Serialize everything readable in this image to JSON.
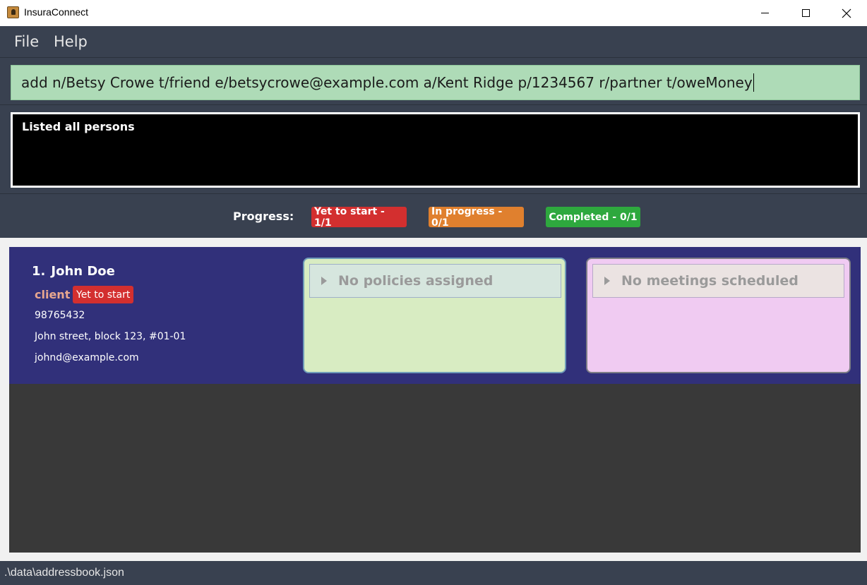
{
  "window": {
    "title": "InsuraConnect",
    "icon": "addressbook-app-icon",
    "controls": [
      "minimize-icon",
      "maximize-icon",
      "close-icon"
    ]
  },
  "menu": {
    "file": "File",
    "help": "Help"
  },
  "command": {
    "value": "add n/Betsy Crowe t/friend e/betsycrowe@example.com a/Kent Ridge p/1234567 r/partner t/oweMoney"
  },
  "result": {
    "message": "Listed all persons"
  },
  "progress": {
    "label": "Progress:",
    "yet_to_start": "Yet to start - 1/1",
    "in_progress": "In progress - 0/1",
    "completed": "Completed - 0/1"
  },
  "persons": [
    {
      "index": "1.",
      "name": "John Doe",
      "tag": "client",
      "status": "Yet to start",
      "phone": "98765432",
      "address": "John street, block 123, #01-01",
      "email": "johnd@example.com",
      "policies_header": "No policies assigned",
      "meetings_header": "No meetings scheduled"
    }
  ],
  "statusbar": {
    "path": ".\\data\\addressbook.json"
  },
  "colors": {
    "panel": "#394150",
    "card": "#31307a",
    "command_bg": "#aedbb7",
    "yet_to_start": "#d32f2f",
    "in_progress": "#e0802e",
    "completed": "#2ea83e",
    "policy_bg": "#d8ecc2",
    "meeting_bg": "#f0cbf2"
  }
}
